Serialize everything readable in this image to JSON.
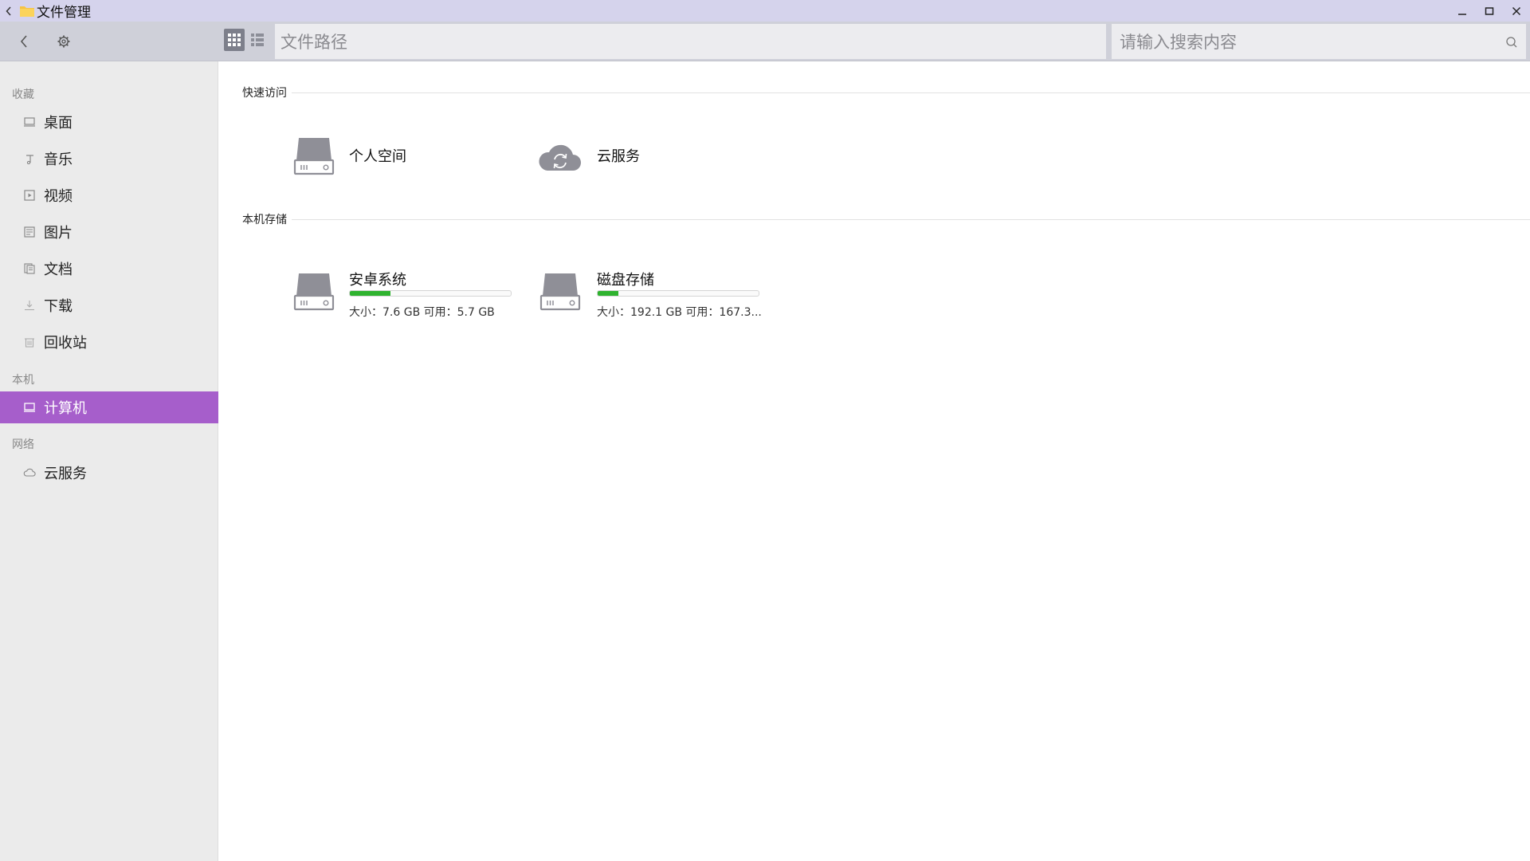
{
  "app": {
    "title": "文件管理"
  },
  "toolbar": {
    "path_placeholder": "文件路径",
    "search_placeholder": "请输入搜索内容"
  },
  "sidebar": {
    "sections": {
      "favorites": "收藏",
      "local": "本机",
      "network": "网络"
    },
    "favorites": [
      {
        "label": "桌面",
        "icon": "desktop-icon"
      },
      {
        "label": "音乐",
        "icon": "music-icon"
      },
      {
        "label": "视频",
        "icon": "video-icon"
      },
      {
        "label": "图片",
        "icon": "picture-icon"
      },
      {
        "label": "文档",
        "icon": "document-icon"
      },
      {
        "label": "下载",
        "icon": "download-icon"
      },
      {
        "label": "回收站",
        "icon": "trash-icon"
      }
    ],
    "local": [
      {
        "label": "计算机",
        "icon": "computer-icon",
        "active": true
      }
    ],
    "network": [
      {
        "label": "云服务",
        "icon": "cloud-icon"
      }
    ],
    "active_color": "#a65ecb"
  },
  "main": {
    "quick_access": {
      "title": "快速访问",
      "items": [
        {
          "label": "个人空间",
          "icon": "drive-icon"
        },
        {
          "label": "云服务",
          "icon": "cloud-sync-icon"
        }
      ]
    },
    "local_storage": {
      "title": "本机存储",
      "items": [
        {
          "label": "安卓系统",
          "usage_fraction": 0.25,
          "info": "大小：7.6 GB    可用：5.7 GB"
        },
        {
          "label": "磁盘存储",
          "usage_fraction": 0.13,
          "info": "大小：192.1 GB    可用：167.3..."
        }
      ],
      "bar_color": "#2fb32f"
    }
  }
}
